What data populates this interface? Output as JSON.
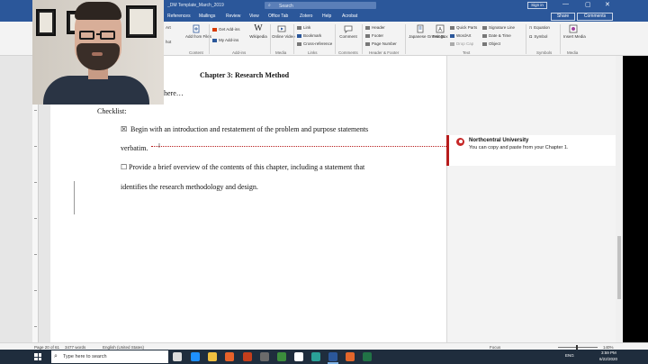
{
  "titlebar": {
    "doc_name": "_DM Template_March_2019",
    "search_placeholder": "Search",
    "search_icon": "search-icon",
    "sign_in": "Sign in",
    "minimize": "—",
    "maximize": "▢",
    "close": "✕"
  },
  "tabs": [
    {
      "label": "References"
    },
    {
      "label": "Mailings"
    },
    {
      "label": "Review"
    },
    {
      "label": "View"
    },
    {
      "label": "Office Tab"
    },
    {
      "label": "Zotero"
    },
    {
      "label": "Help"
    },
    {
      "label": "Acrobat"
    }
  ],
  "tab_actions": {
    "share": "Share",
    "comments": "Comments"
  },
  "ribbon": {
    "art_partial": "Art",
    "smartart_partial": "hot",
    "add_from_files": "Add from Files",
    "get_addins": "Get Add-ins",
    "my_addins": "My Add-ins",
    "wikipedia": "Wikipedia",
    "online_video": "Online Video",
    "link": "Link",
    "bookmark": "Bookmark",
    "cross_reference": "Cross-reference",
    "comment": "Comment",
    "header": "Header",
    "footer": "Footer",
    "page_number": "Page Number",
    "japanese_greetings": "Japanese Greetings",
    "text_box": "Text Box",
    "quick_parts": "Quick Parts",
    "wordart": "WordArt",
    "drop_cap": "Drop Cap",
    "signature_line": "Signature Line",
    "date_time": "Date & Time",
    "object": "Object",
    "equation": "Equation",
    "symbol": "Symbol",
    "insert_media": "Insert Media",
    "groups": {
      "content": "Content",
      "addins": "Add-ins",
      "media": "Media",
      "links": "Links",
      "comments": "Comments",
      "header_footer": "Header & Footer",
      "text": "Text",
      "symbols": "Symbols",
      "media2": "Media"
    }
  },
  "document": {
    "chapter_title": "Chapter 3: Research Method",
    "here_text": "here…",
    "checklist_label": "Checklist:",
    "item1_line1": "Begin with an introduction and restatement of the problem and purpose statements",
    "item1_line2": "verbatim.",
    "item1_checkbox": "☒",
    "item2_line1": "Provide a brief overview of the contents of this chapter, including a statement that",
    "item2_line2": "identifies the research methodology and design.",
    "item2_checkbox": "☐",
    "cursor": "I"
  },
  "comment": {
    "author": "Northcentral University",
    "text": "You can copy and paste from your Chapter 1.",
    "avatar_icon": "user-avatar-icon"
  },
  "statusbar": {
    "page": "Page 20 of 61",
    "words": "3477 words",
    "language": "English (United States)",
    "focus": "Focus",
    "zoom": "140%"
  },
  "taskbar": {
    "search_placeholder": "Type here to search",
    "language": "ENG",
    "time": "3:59 PM",
    "date": "6/22/2020"
  },
  "colors": {
    "word_blue": "#2b579a",
    "comment_red": "#b71c1c",
    "taskbar": "#1f2d3d"
  }
}
